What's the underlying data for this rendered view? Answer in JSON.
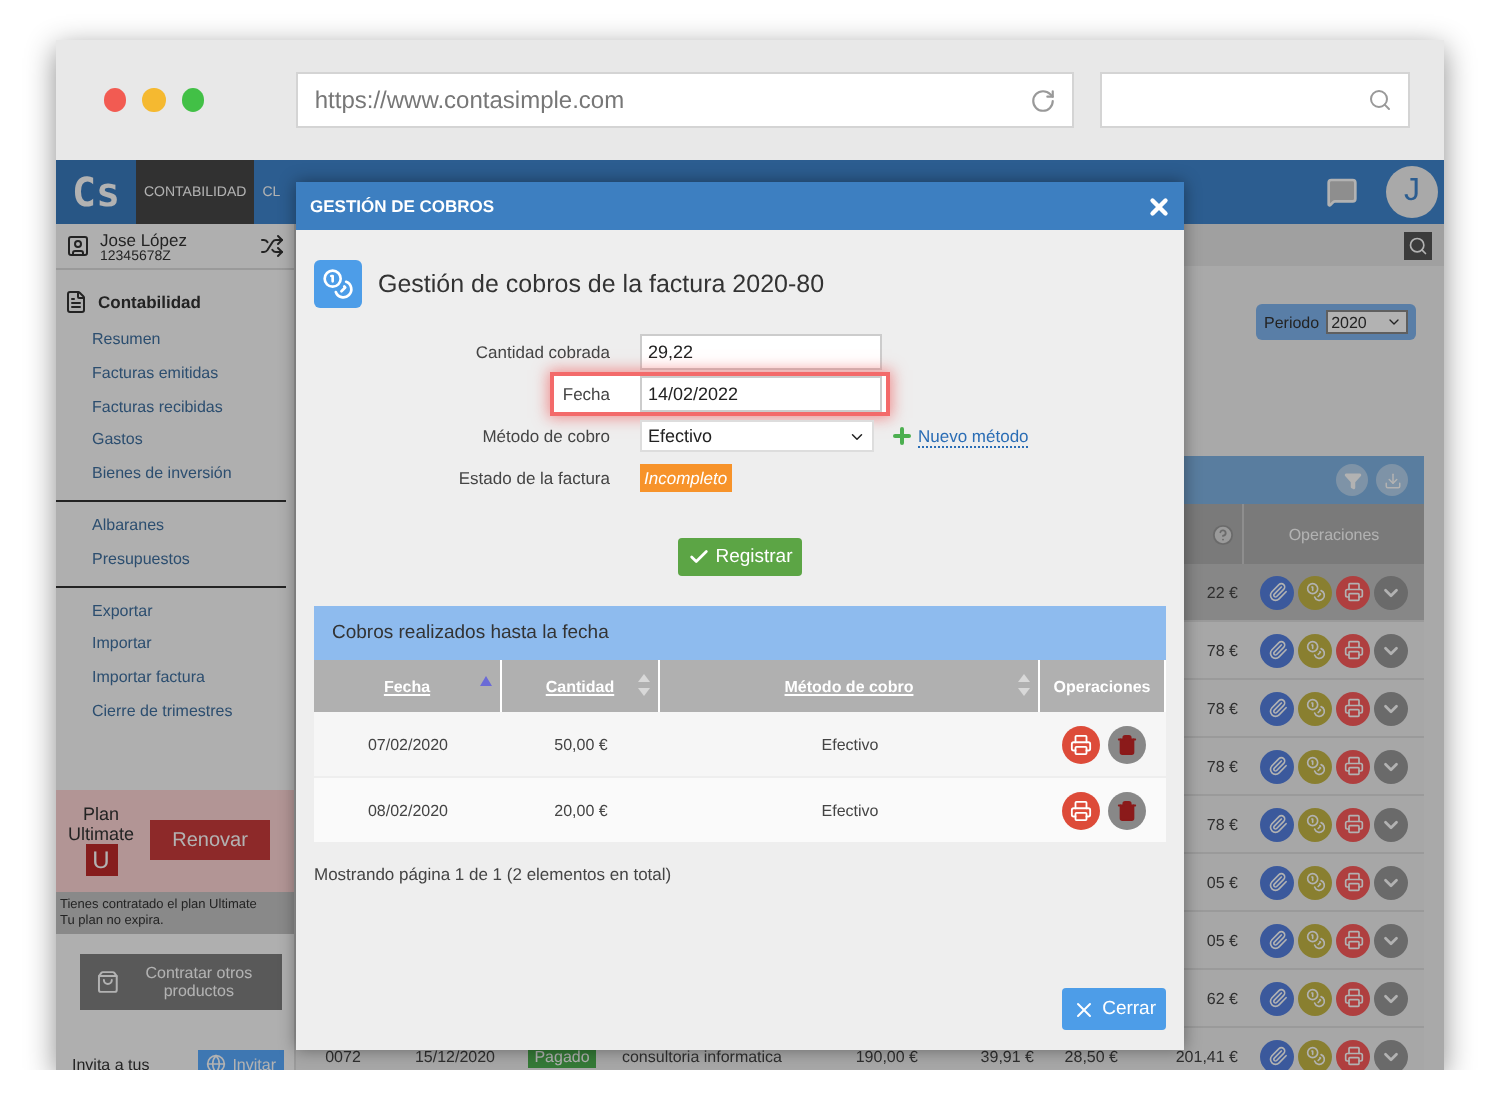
{
  "browser": {
    "url": "https://www.contasimple.com"
  },
  "nav": {
    "logo": "Cs",
    "tabs": [
      {
        "label": "CONTABILIDAD",
        "selected": true
      },
      {
        "label": "CL",
        "selected": false
      }
    ],
    "avatar": "J"
  },
  "sidebar": {
    "user_name": "Jose López",
    "user_id": "12345678Z",
    "section": "Contabilidad",
    "groups": [
      {
        "items": [
          {
            "label": "Resumen"
          },
          {
            "label": "Facturas emitidas"
          },
          {
            "label": "Facturas recibidas"
          },
          {
            "label": "Gastos"
          },
          {
            "label": "Bienes de inversión"
          }
        ]
      },
      {
        "items": [
          {
            "label": "Albaranes"
          },
          {
            "label": "Presupuestos"
          }
        ]
      },
      {
        "items": [
          {
            "label": "Exportar"
          },
          {
            "label": "Importar"
          },
          {
            "label": "Importar factura"
          },
          {
            "label": "Cierre de trimestres"
          }
        ]
      }
    ],
    "plan": {
      "label": "Plan",
      "name": "Ultimate",
      "badge": "U",
      "button": "Renovar"
    },
    "plan_notes": [
      "Tienes contratado el plan Ultimate",
      "Tu plan no expira."
    ],
    "products_button": "Contratar otros productos",
    "invite_text": "Invita a tus",
    "invite_button": "Invitar"
  },
  "main": {
    "period": {
      "label": "Periodo",
      "value": "2020"
    },
    "table": {
      "operations_header": "Operaciones",
      "rows": [
        {
          "selected": true,
          "total": "22 €"
        },
        {
          "selected": false,
          "total": "78 €"
        },
        {
          "selected": false,
          "total": "78 €"
        },
        {
          "selected": false,
          "total": "78 €"
        },
        {
          "selected": false,
          "total": "78 €"
        },
        {
          "selected": false,
          "total": "05 €"
        },
        {
          "selected": false,
          "total": "05 €"
        },
        {
          "selected": false,
          "total": "62 €"
        },
        {
          "selected": false,
          "number": "0072",
          "date": "15/12/2020",
          "status": "Pagado",
          "concept": "consultoria informatica",
          "amount_1": "190,00 €",
          "amount_2": "39,91 €",
          "amount_3": "28,50 €",
          "total": "201,41 €"
        }
      ]
    }
  },
  "modal": {
    "title": "GESTIÓN DE COBROS",
    "heading": "Gestión de cobros de la factura 2020-80",
    "fields": [
      {
        "kind": "input",
        "label": "Cantidad cobrada",
        "value": "29,22",
        "highlighted": false
      },
      {
        "kind": "input",
        "label": "Fecha",
        "value": "14/02/2022",
        "highlighted": true
      },
      {
        "kind": "select",
        "label": "Método de cobro",
        "value": "Efectivo",
        "highlighted": false,
        "link": "Nuevo método"
      },
      {
        "kind": "badge",
        "label": "Estado de la factura",
        "value": "Incompleto",
        "highlighted": false
      }
    ],
    "submit": "Registrar",
    "payments": {
      "title": "Cobros realizados hasta la fecha",
      "columns": [
        {
          "label": "Fecha",
          "sortable": true,
          "sorted_ascending": true
        },
        {
          "label": "Cantidad",
          "sortable": true,
          "sorted_ascending": false
        },
        {
          "label": "Método de cobro",
          "sortable": true,
          "sorted_ascending": false
        },
        {
          "label": "Operaciones",
          "sortable": false
        }
      ],
      "rows": [
        {
          "date": "07/02/2020",
          "amount": "50,00 €",
          "method": "Efectivo"
        },
        {
          "date": "08/02/2020",
          "amount": "20,00 €",
          "method": "Efectivo"
        }
      ]
    },
    "pager": "Mostrando página 1 de 1 (2 elementos en total)",
    "close": "Cerrar"
  }
}
